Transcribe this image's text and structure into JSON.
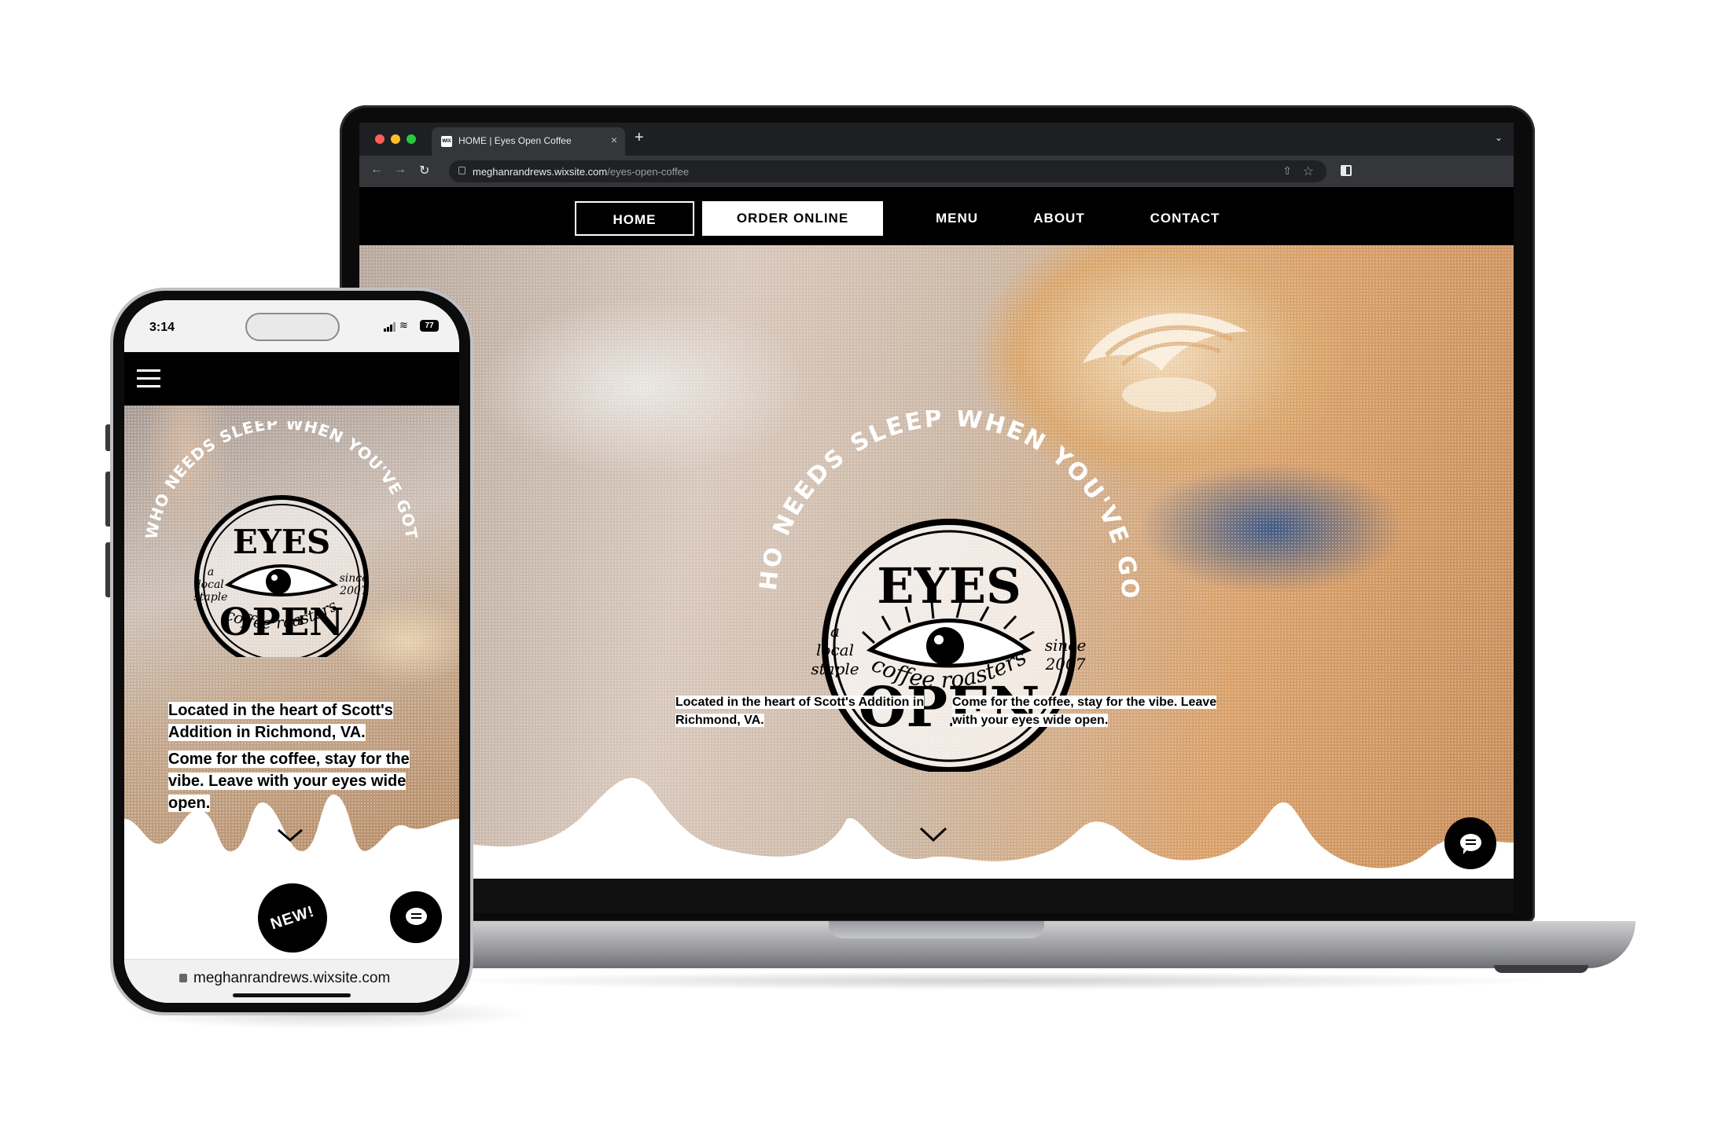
{
  "laptop": {
    "browser": {
      "tab_title": "HOME | Eyes Open Coffee",
      "tab_favicon": "WIX",
      "tab_close": "×",
      "new_tab": "+",
      "tab_menu": "⌄",
      "url_host": "meghanrandrews.wixsite.com",
      "url_path": "/eyes-open-coffee"
    },
    "nav": {
      "items": [
        "HOME",
        "ORDER ONLINE",
        "MENU",
        "ABOUT",
        "CONTACT"
      ]
    },
    "hero": {
      "text_1": "Located in the heart of Scott's Addition in Richmond, VA.",
      "text_2": "Come for the coffee, stay for the vibe. Leave with your eyes wide open."
    }
  },
  "logo": {
    "arc_text": "WHO NEEDS SLEEP WHEN YOU'VE GOT",
    "top_word": "EYES",
    "bottom_word": "OPEN",
    "left_tag": [
      "a",
      "local",
      "staple"
    ],
    "right_tag": [
      "since",
      "2007"
    ],
    "tagline": "coffee roasters"
  },
  "phone": {
    "status_time": "3:14",
    "battery": "77",
    "hero": {
      "text_1": "Located in the heart of Scott's Addition in Richmond, VA.",
      "text_2": "Come for the coffee, stay for the vibe. Leave with your eyes wide open."
    },
    "badge": "NEW!",
    "url": "meghanrandrews.wixsite.com"
  },
  "icons": {
    "hamburger": "hamburger-icon",
    "chevron": "chevron-down-icon",
    "chat": "chat-icon",
    "lock": "lock-icon"
  },
  "colors": {
    "nav_bg": "#000000",
    "accent": "#ffffff",
    "chrome_bg": "#35363a"
  }
}
